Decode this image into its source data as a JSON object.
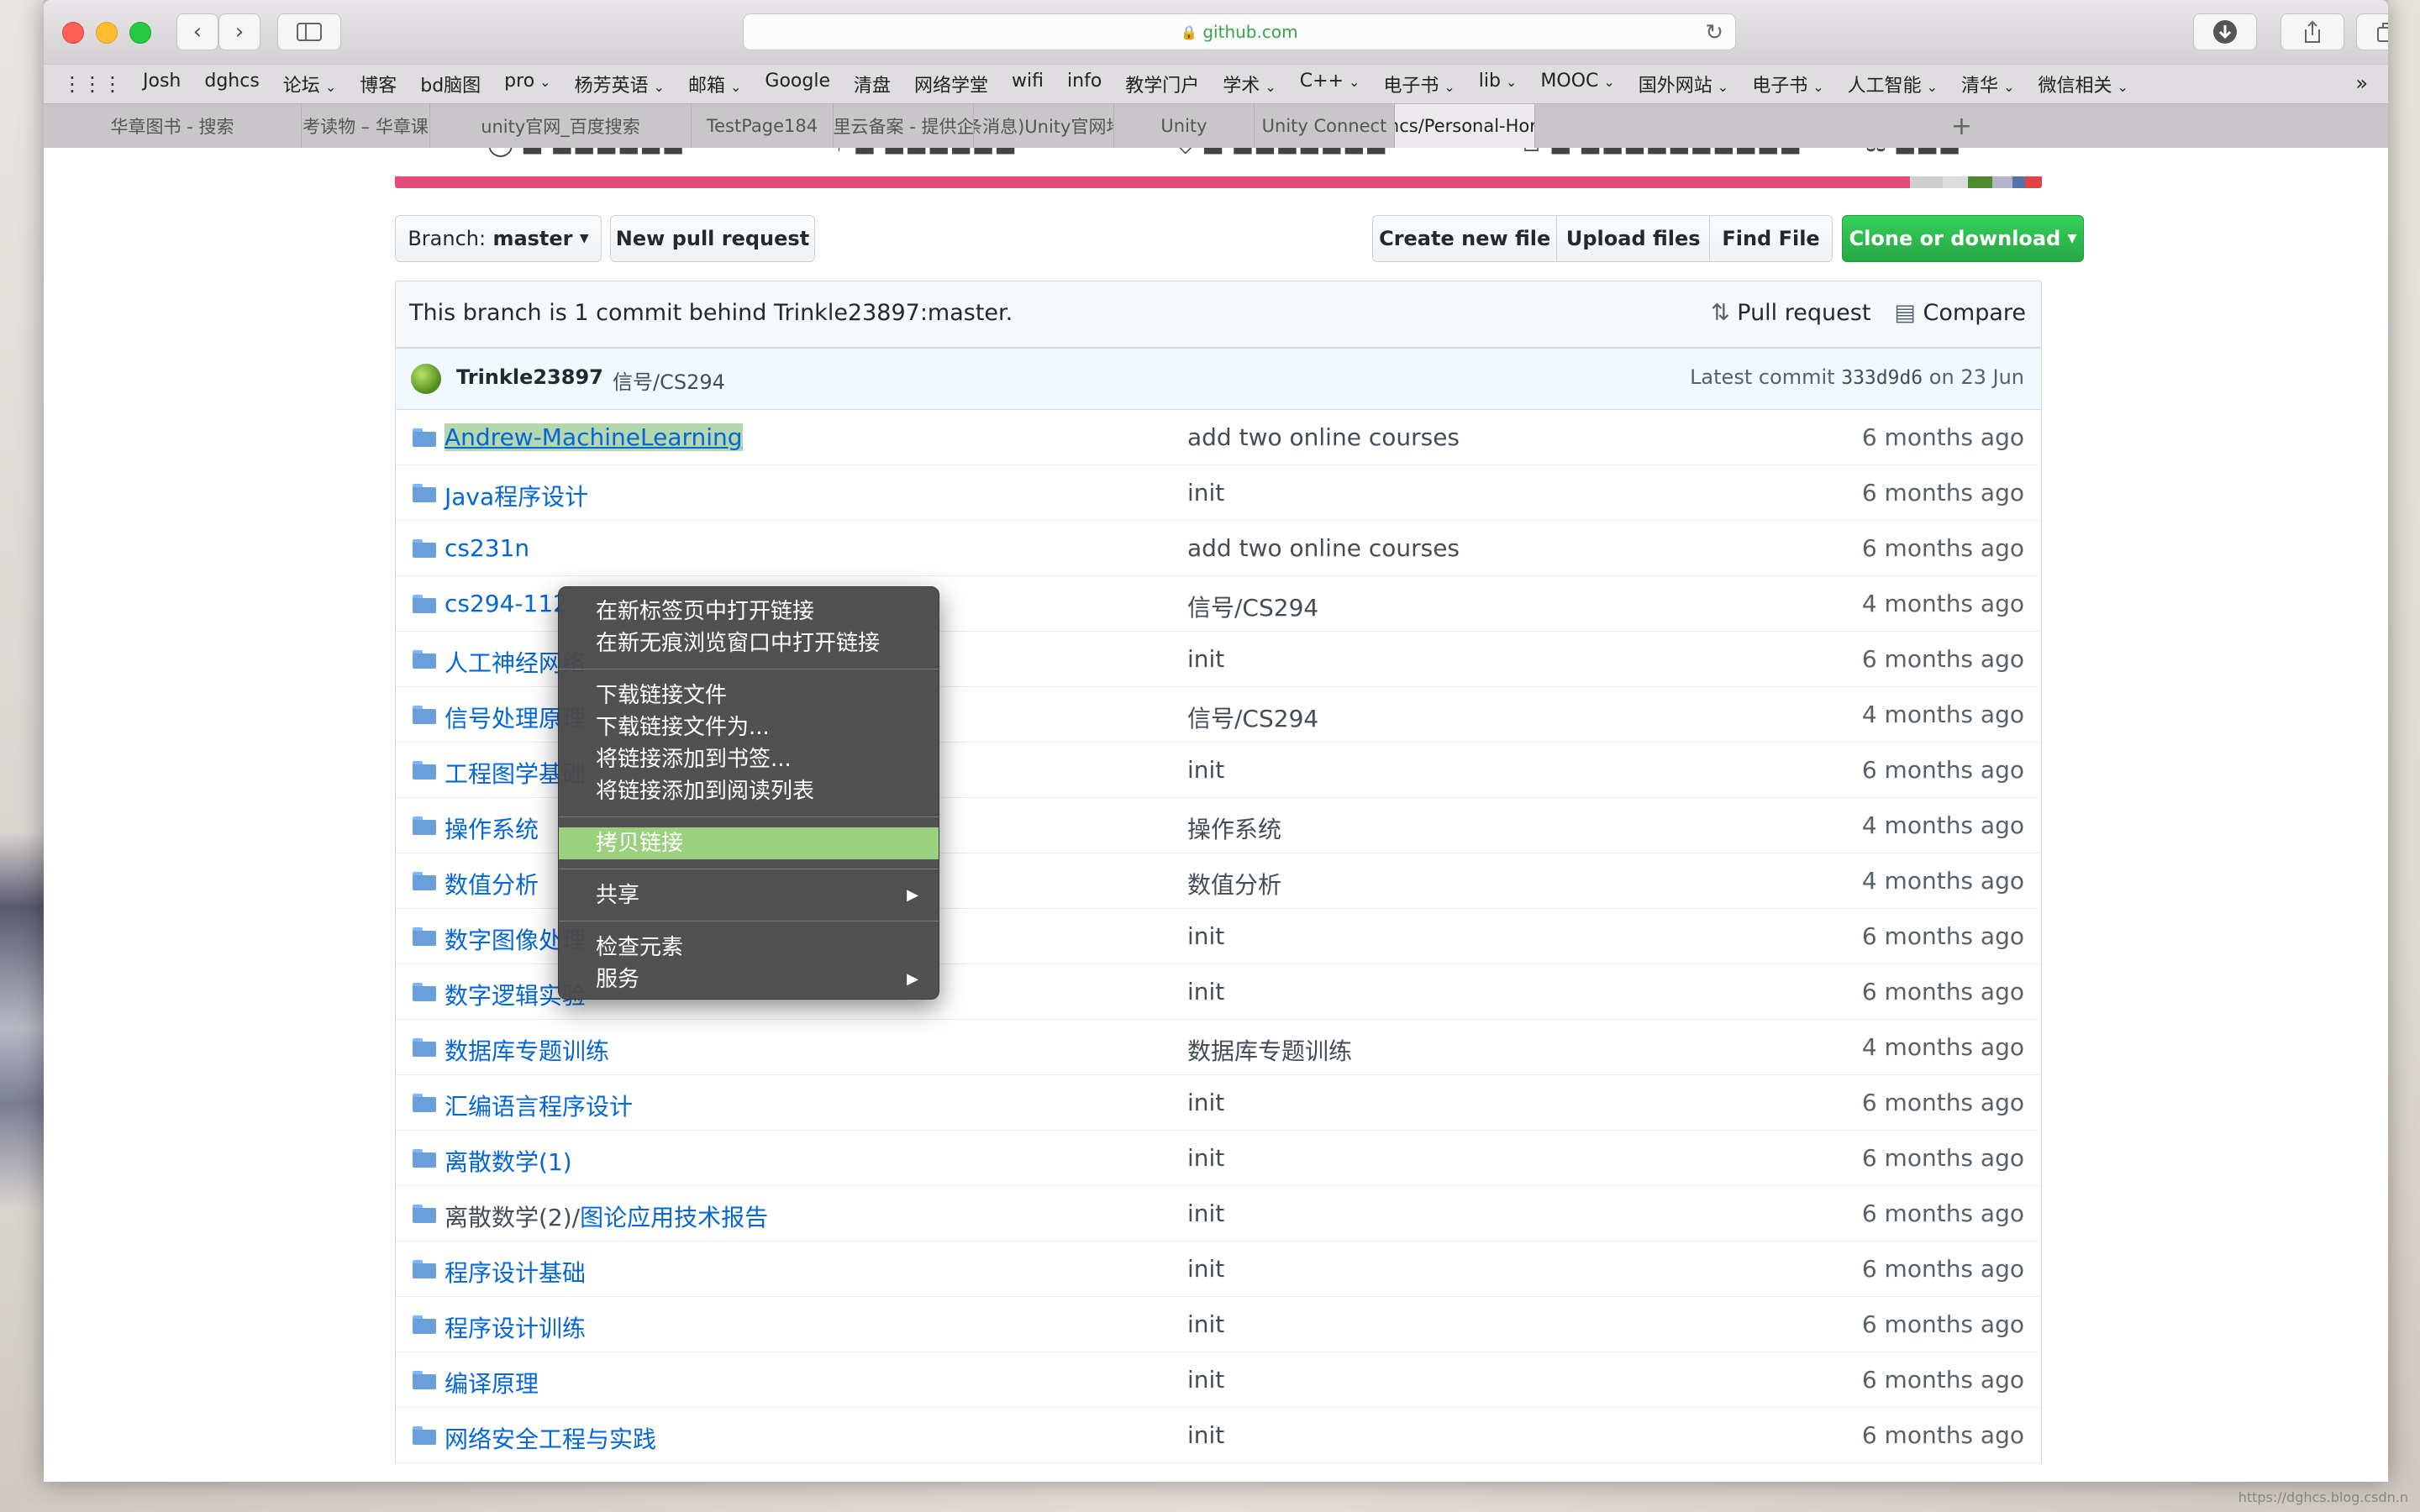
{
  "browser": {
    "address_text": "github.com",
    "bookmarks": [
      {
        "label": "Josh",
        "menu": false
      },
      {
        "label": "dghcs",
        "menu": false
      },
      {
        "label": "论坛",
        "menu": true
      },
      {
        "label": "博客",
        "menu": false
      },
      {
        "label": "bd脑图",
        "menu": false
      },
      {
        "label": "pro",
        "menu": true
      },
      {
        "label": "杨芳英语",
        "menu": true
      },
      {
        "label": "邮箱",
        "menu": true
      },
      {
        "label": "Google",
        "menu": false
      },
      {
        "label": "清盘",
        "menu": false
      },
      {
        "label": "网络学堂",
        "menu": false
      },
      {
        "label": "wifi",
        "menu": false
      },
      {
        "label": "info",
        "menu": false
      },
      {
        "label": "教学门户",
        "menu": false
      },
      {
        "label": "学术",
        "menu": true
      },
      {
        "label": "C++",
        "menu": true
      },
      {
        "label": "电子书",
        "menu": true
      },
      {
        "label": "lib",
        "menu": true
      },
      {
        "label": "MOOC",
        "menu": true
      },
      {
        "label": "国外网站",
        "menu": true
      },
      {
        "label": "电子书",
        "menu": true
      },
      {
        "label": "人工智能",
        "menu": true
      },
      {
        "label": "清华",
        "menu": true
      },
      {
        "label": "微信相关",
        "menu": true
      }
    ],
    "bookmarks_more": "»",
    "tabs": [
      {
        "label": "华章图书 - 搜索",
        "active": false
      },
      {
        "label": "参考读物 – 华章课堂",
        "active": false
      },
      {
        "label": "unity官网_百度搜索",
        "active": false
      },
      {
        "label": "TestPage184",
        "active": false
      },
      {
        "label": "阿里云备案 - 提供企...",
        "active": false
      },
      {
        "label": "(2条消息)Unity官网地...",
        "active": false
      },
      {
        "label": "Unity",
        "active": false
      },
      {
        "label": "Unity Connect",
        "active": false
      },
      {
        "label": "dghcs/Personal-Hom...",
        "active": true
      }
    ],
    "new_tab": "+"
  },
  "repo": {
    "language_colors": [
      "#e34c7a",
      "#cfcfcf",
      "#dcdcdc",
      "#4e8a2e",
      "#b5b5c8",
      "#5572a8",
      "#d44"
    ],
    "language_shares": [
      0.92,
      0.02,
      0.015,
      0.015,
      0.012,
      0.008,
      0.01
    ],
    "branch_label": "Branch:",
    "branch_name": "master",
    "new_pull_request": "New pull request",
    "create_new_file": "Create new file",
    "upload_files": "Upload files",
    "find_file": "Find File",
    "clone_or_download": "Clone or download",
    "behind_text": "This branch is 1 commit behind Trinkle23897:master.",
    "pull_request": "Pull request",
    "compare": "Compare",
    "commit": {
      "author": "Trinkle23897",
      "message": "信号/CS294",
      "latest_prefix": "Latest commit",
      "sha": "333d9d6",
      "date": "on 23 Jun"
    },
    "files": [
      {
        "name": "Andrew-MachineLearning",
        "link_part": "",
        "message": "add two online courses",
        "age": "6 months ago"
      },
      {
        "name": "Java程序设计",
        "link_part": "",
        "message": "init",
        "age": "6 months ago"
      },
      {
        "name": "cs231n",
        "link_part": "",
        "message": "add two online courses",
        "age": "6 months ago"
      },
      {
        "name": "cs294-112",
        "link_part": "",
        "message": "信号/CS294",
        "age": "4 months ago"
      },
      {
        "name": "人工神经网络",
        "link_part": "",
        "message": "init",
        "age": "6 months ago"
      },
      {
        "name": "信号处理原理",
        "link_part": "",
        "message": "信号/CS294",
        "age": "4 months ago"
      },
      {
        "name": "工程图学基础",
        "link_part": "",
        "message": "init",
        "age": "6 months ago"
      },
      {
        "name": "操作系统",
        "link_part": "",
        "message": "操作系统",
        "age": "4 months ago"
      },
      {
        "name": "数值分析",
        "link_part": "",
        "message": "数值分析",
        "age": "4 months ago"
      },
      {
        "name": "数字图像处理",
        "link_part": "",
        "message": "init",
        "age": "6 months ago"
      },
      {
        "name": "数字逻辑实验",
        "link_part": "",
        "message": "init",
        "age": "6 months ago"
      },
      {
        "name": "数据库专题训练",
        "link_part": "",
        "message": "数据库专题训练",
        "age": "4 months ago"
      },
      {
        "name": "汇编语言程序设计",
        "link_part": "",
        "message": "init",
        "age": "6 months ago"
      },
      {
        "name": "离散数学(1)",
        "link_part": "",
        "message": "init",
        "age": "6 months ago"
      },
      {
        "name": "离散数学(2)/",
        "link_part": "图论应用技术报告",
        "message": "init",
        "age": "6 months ago"
      },
      {
        "name": "程序设计基础",
        "link_part": "",
        "message": "init",
        "age": "6 months ago"
      },
      {
        "name": "程序设计训练",
        "link_part": "",
        "message": "init",
        "age": "6 months ago"
      },
      {
        "name": "编译原理",
        "link_part": "",
        "message": "init",
        "age": "6 months ago"
      },
      {
        "name": "网络安全工程与实践",
        "link_part": "",
        "message": "init",
        "age": "6 months ago"
      }
    ]
  },
  "context_menu": {
    "groups": [
      [
        "在新标签页中打开链接",
        "在新无痕浏览窗口中打开链接"
      ],
      [
        "下载链接文件",
        "下载链接文件为...",
        "将链接添加到书签...",
        "将链接添加到阅读列表"
      ],
      [
        "拷贝链接"
      ],
      [
        "共享"
      ],
      [
        "检查元素",
        "服务"
      ]
    ],
    "highlighted": "拷贝链接",
    "submenu_items": [
      "共享",
      "服务"
    ]
  },
  "watermark": "https://dghcs.blog.csdn.n"
}
